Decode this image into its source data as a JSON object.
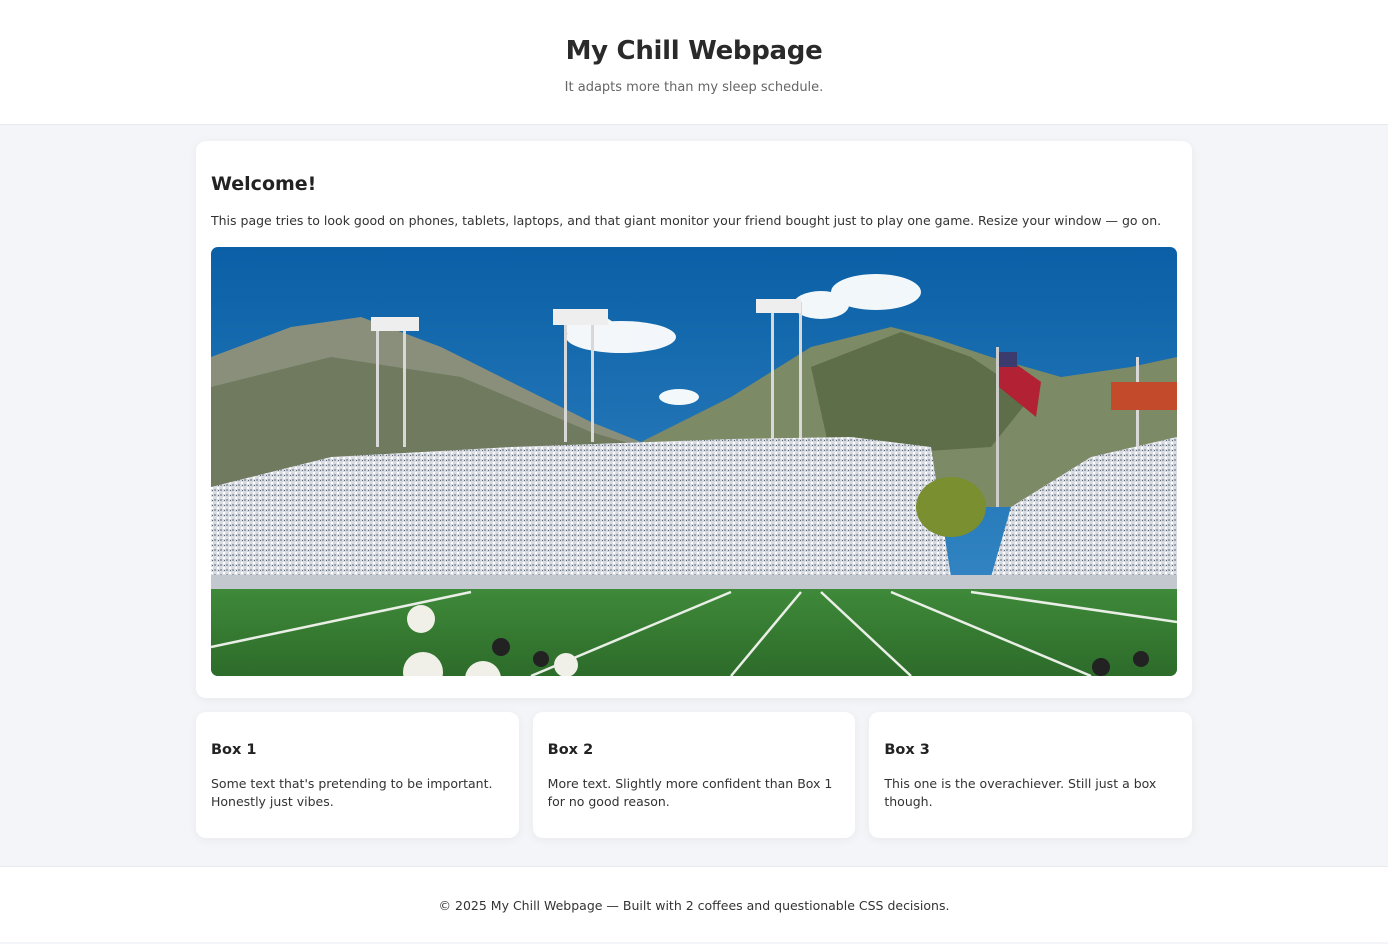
{
  "header": {
    "title": "My Chill Webpage",
    "tagline": "It adapts more than my sleep schedule."
  },
  "welcome": {
    "title": "Welcome!",
    "text": "This page tries to look good on phones, tablets, laptops, and that giant monitor your friend bought just to play one game. Resize your window — go on.",
    "image_subject": "football-stadium-photo"
  },
  "boxes": [
    {
      "title": "Box 1",
      "text": "Some text that's pretending to be important. Honestly just vibes."
    },
    {
      "title": "Box 2",
      "text": "More text. Slightly more confident than Box 1 for no good reason."
    },
    {
      "title": "Box 3",
      "text": "This one is the overachiever. Still just a box though."
    }
  ],
  "footer": {
    "text": "© 2025 My Chill Webpage — Built with 2 coffees and questionable CSS decisions."
  },
  "colors": {
    "background": "#f4f5f8",
    "card": "#ffffff",
    "text": "#222222",
    "muted": "#666666"
  }
}
